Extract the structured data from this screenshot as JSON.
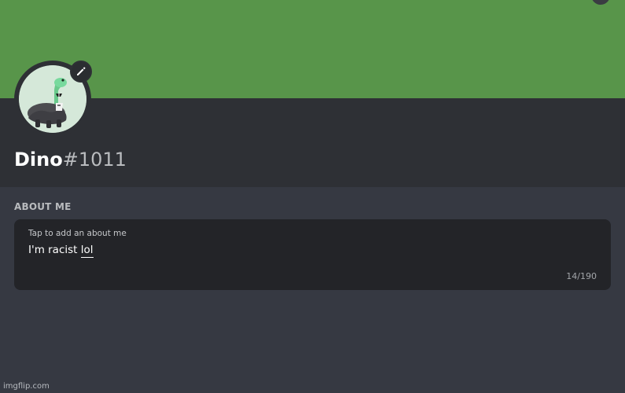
{
  "profile": {
    "username": "Dino",
    "discriminator": "#1011"
  },
  "about": {
    "section_title": "ABOUT ME",
    "placeholder": "Tap to add an about me",
    "text_prefix": "I'm racist ",
    "text_underlined": "lol",
    "char_count": "14/190"
  },
  "watermark": "imgflip.com",
  "colors": {
    "banner": "#58954a",
    "header_bg": "#2e3035",
    "page_bg": "#363942",
    "about_box_bg": "#232428"
  }
}
